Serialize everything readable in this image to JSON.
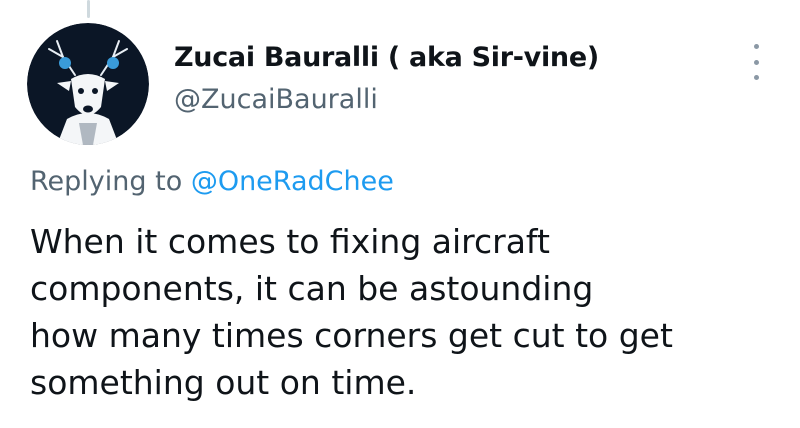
{
  "author": {
    "display_name": "Zucai Bauralli ( aka Sir-vine)",
    "handle": "@ZucaiBauralli",
    "avatar_icon": "stag-avatar-icon"
  },
  "reply": {
    "prefix": "Replying to",
    "mention": "@OneRadChee"
  },
  "tweet": {
    "lines": [
      "When it comes to fixing aircraft",
      "components, it can be astounding",
      "how many times corners get cut to get",
      "something out on time."
    ]
  },
  "colors": {
    "text": "#0f1419",
    "secondary": "#536471",
    "link": "#1d9bf0",
    "avatar_bg": "#0b1626",
    "avatar_eye": "#3a9bd9"
  },
  "icons": {
    "more": "more-vertical-icon"
  }
}
